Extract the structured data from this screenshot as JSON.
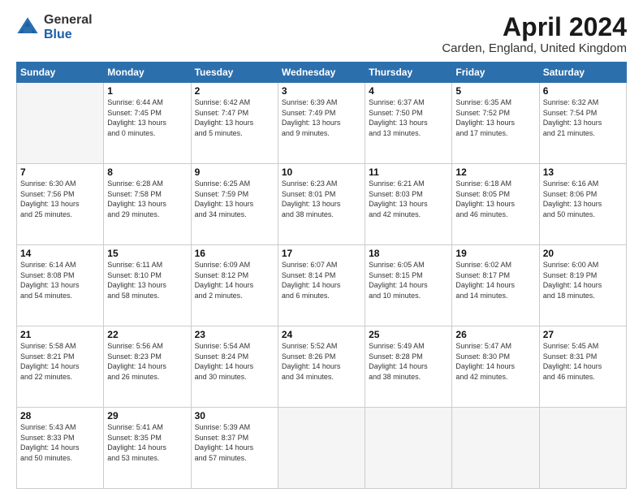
{
  "header": {
    "logo_general": "General",
    "logo_blue": "Blue",
    "month_title": "April 2024",
    "location": "Carden, England, United Kingdom"
  },
  "days_of_week": [
    "Sunday",
    "Monday",
    "Tuesday",
    "Wednesday",
    "Thursday",
    "Friday",
    "Saturday"
  ],
  "weeks": [
    [
      {
        "day": "",
        "info": ""
      },
      {
        "day": "1",
        "info": "Sunrise: 6:44 AM\nSunset: 7:45 PM\nDaylight: 13 hours\nand 0 minutes."
      },
      {
        "day": "2",
        "info": "Sunrise: 6:42 AM\nSunset: 7:47 PM\nDaylight: 13 hours\nand 5 minutes."
      },
      {
        "day": "3",
        "info": "Sunrise: 6:39 AM\nSunset: 7:49 PM\nDaylight: 13 hours\nand 9 minutes."
      },
      {
        "day": "4",
        "info": "Sunrise: 6:37 AM\nSunset: 7:50 PM\nDaylight: 13 hours\nand 13 minutes."
      },
      {
        "day": "5",
        "info": "Sunrise: 6:35 AM\nSunset: 7:52 PM\nDaylight: 13 hours\nand 17 minutes."
      },
      {
        "day": "6",
        "info": "Sunrise: 6:32 AM\nSunset: 7:54 PM\nDaylight: 13 hours\nand 21 minutes."
      }
    ],
    [
      {
        "day": "7",
        "info": "Sunrise: 6:30 AM\nSunset: 7:56 PM\nDaylight: 13 hours\nand 25 minutes."
      },
      {
        "day": "8",
        "info": "Sunrise: 6:28 AM\nSunset: 7:58 PM\nDaylight: 13 hours\nand 29 minutes."
      },
      {
        "day": "9",
        "info": "Sunrise: 6:25 AM\nSunset: 7:59 PM\nDaylight: 13 hours\nand 34 minutes."
      },
      {
        "day": "10",
        "info": "Sunrise: 6:23 AM\nSunset: 8:01 PM\nDaylight: 13 hours\nand 38 minutes."
      },
      {
        "day": "11",
        "info": "Sunrise: 6:21 AM\nSunset: 8:03 PM\nDaylight: 13 hours\nand 42 minutes."
      },
      {
        "day": "12",
        "info": "Sunrise: 6:18 AM\nSunset: 8:05 PM\nDaylight: 13 hours\nand 46 minutes."
      },
      {
        "day": "13",
        "info": "Sunrise: 6:16 AM\nSunset: 8:06 PM\nDaylight: 13 hours\nand 50 minutes."
      }
    ],
    [
      {
        "day": "14",
        "info": "Sunrise: 6:14 AM\nSunset: 8:08 PM\nDaylight: 13 hours\nand 54 minutes."
      },
      {
        "day": "15",
        "info": "Sunrise: 6:11 AM\nSunset: 8:10 PM\nDaylight: 13 hours\nand 58 minutes."
      },
      {
        "day": "16",
        "info": "Sunrise: 6:09 AM\nSunset: 8:12 PM\nDaylight: 14 hours\nand 2 minutes."
      },
      {
        "day": "17",
        "info": "Sunrise: 6:07 AM\nSunset: 8:14 PM\nDaylight: 14 hours\nand 6 minutes."
      },
      {
        "day": "18",
        "info": "Sunrise: 6:05 AM\nSunset: 8:15 PM\nDaylight: 14 hours\nand 10 minutes."
      },
      {
        "day": "19",
        "info": "Sunrise: 6:02 AM\nSunset: 8:17 PM\nDaylight: 14 hours\nand 14 minutes."
      },
      {
        "day": "20",
        "info": "Sunrise: 6:00 AM\nSunset: 8:19 PM\nDaylight: 14 hours\nand 18 minutes."
      }
    ],
    [
      {
        "day": "21",
        "info": "Sunrise: 5:58 AM\nSunset: 8:21 PM\nDaylight: 14 hours\nand 22 minutes."
      },
      {
        "day": "22",
        "info": "Sunrise: 5:56 AM\nSunset: 8:23 PM\nDaylight: 14 hours\nand 26 minutes."
      },
      {
        "day": "23",
        "info": "Sunrise: 5:54 AM\nSunset: 8:24 PM\nDaylight: 14 hours\nand 30 minutes."
      },
      {
        "day": "24",
        "info": "Sunrise: 5:52 AM\nSunset: 8:26 PM\nDaylight: 14 hours\nand 34 minutes."
      },
      {
        "day": "25",
        "info": "Sunrise: 5:49 AM\nSunset: 8:28 PM\nDaylight: 14 hours\nand 38 minutes."
      },
      {
        "day": "26",
        "info": "Sunrise: 5:47 AM\nSunset: 8:30 PM\nDaylight: 14 hours\nand 42 minutes."
      },
      {
        "day": "27",
        "info": "Sunrise: 5:45 AM\nSunset: 8:31 PM\nDaylight: 14 hours\nand 46 minutes."
      }
    ],
    [
      {
        "day": "28",
        "info": "Sunrise: 5:43 AM\nSunset: 8:33 PM\nDaylight: 14 hours\nand 50 minutes."
      },
      {
        "day": "29",
        "info": "Sunrise: 5:41 AM\nSunset: 8:35 PM\nDaylight: 14 hours\nand 53 minutes."
      },
      {
        "day": "30",
        "info": "Sunrise: 5:39 AM\nSunset: 8:37 PM\nDaylight: 14 hours\nand 57 minutes."
      },
      {
        "day": "",
        "info": ""
      },
      {
        "day": "",
        "info": ""
      },
      {
        "day": "",
        "info": ""
      },
      {
        "day": "",
        "info": ""
      }
    ]
  ]
}
